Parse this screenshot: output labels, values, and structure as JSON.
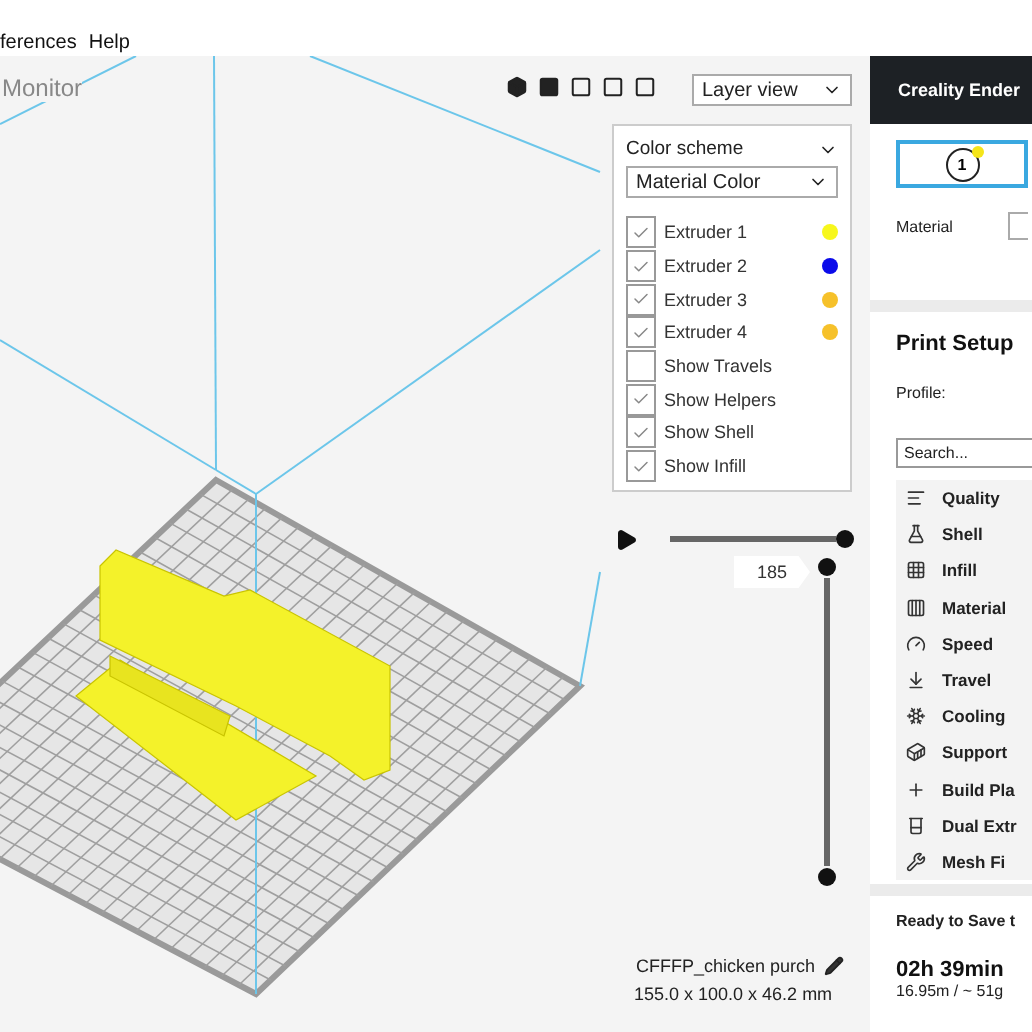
{
  "menu": [
    {
      "label": "ferences"
    },
    {
      "label": "Help"
    }
  ],
  "stage": {
    "label": "Monitor"
  },
  "view_dropdown": {
    "value": "Layer view"
  },
  "color_scheme": {
    "title": "Color scheme",
    "value": "Material Color",
    "options": [
      {
        "kind": "extruder",
        "label": "Extruder 1",
        "checked": true,
        "color": "#f7f71c"
      },
      {
        "kind": "extruder",
        "label": "Extruder 2",
        "checked": true,
        "color": "#0b0bea"
      },
      {
        "kind": "extruder",
        "label": "Extruder 3",
        "checked": true,
        "color": "#f6c12a"
      },
      {
        "kind": "extruder",
        "label": "Extruder 4",
        "checked": true,
        "color": "#f6c12a"
      },
      {
        "kind": "option",
        "label": "Show Travels",
        "checked": false
      },
      {
        "kind": "option",
        "label": "Show Helpers",
        "checked": true
      },
      {
        "kind": "option",
        "label": "Show Shell",
        "checked": true
      },
      {
        "kind": "option",
        "label": "Show Infill",
        "checked": true
      }
    ]
  },
  "path_slider": {
    "level": 1
  },
  "layer_slider": {
    "reading": "185"
  },
  "object": {
    "name": "CFFFP_chicken purch",
    "dimensions": "155.0 x 100.0 x 46.2 mm"
  },
  "printer": {
    "name": "Creality Ender",
    "extruder_tab": {
      "number": "1",
      "selected": true
    },
    "material_label": "Material"
  },
  "print_setup": {
    "title": "Print Setup",
    "profile_label": "Profile:",
    "search": {
      "placeholder": "Search..."
    },
    "categories": [
      {
        "label": "Quality"
      },
      {
        "label": "Shell"
      },
      {
        "label": "Infill"
      },
      {
        "label": "Material"
      },
      {
        "label": "Speed"
      },
      {
        "label": "Travel"
      },
      {
        "label": "Cooling"
      },
      {
        "label": "Support"
      },
      {
        "label": "Build Pla"
      },
      {
        "label": "Dual Extr"
      },
      {
        "label": "Mesh Fi"
      }
    ]
  },
  "status": {
    "title": "Ready to Save t",
    "time": "02h 39min",
    "usage": "16.95m / ~ 51g"
  }
}
